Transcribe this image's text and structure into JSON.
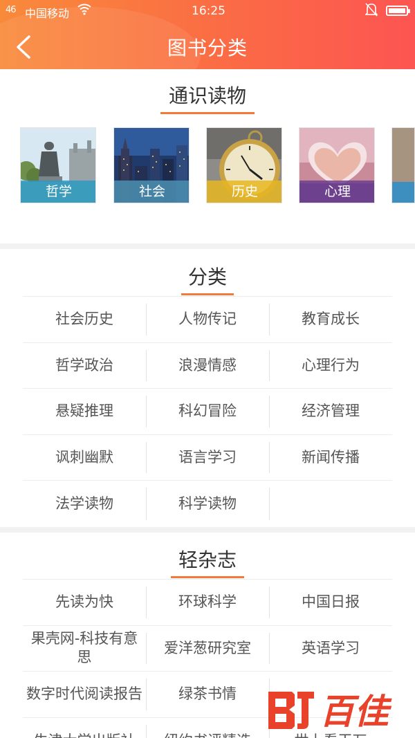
{
  "status_bar": {
    "signal": "46",
    "carrier": "中国移动",
    "time": "16:25"
  },
  "header": {
    "title": "图书分类"
  },
  "general_reading": {
    "title": "通识读物",
    "topics": [
      {
        "label": "哲学",
        "band_color": "#2e97c9",
        "icon": "statue-image"
      },
      {
        "label": "社会",
        "band_color": "#4a8fb0",
        "icon": "city-skyline-image"
      },
      {
        "label": "历史",
        "band_color": "#e6b621",
        "icon": "pocket-watch-image"
      },
      {
        "label": "心理",
        "band_color": "#6c3f8f",
        "icon": "book-heart-image"
      }
    ]
  },
  "categories": {
    "title": "分类",
    "rows": [
      [
        "社会历史",
        "人物传记",
        "教育成长"
      ],
      [
        "哲学政治",
        "浪漫情感",
        "心理行为"
      ],
      [
        "悬疑推理",
        "科幻冒险",
        "经济管理"
      ],
      [
        "讽刺幽默",
        "语言学习",
        "新闻传播"
      ],
      [
        "法学读物",
        "科学读物",
        ""
      ]
    ]
  },
  "light_magazines": {
    "title": "轻杂志",
    "rows": [
      [
        "先读为快",
        "环球科学",
        "中国日报"
      ],
      [
        "果壳网-科技有意思",
        "爱洋葱研究室",
        "英语学习"
      ],
      [
        "数字时代阅读报告",
        "绿茶书情",
        ""
      ],
      [
        "牛津大学出版社",
        "纽约书评精选",
        "世上看干万"
      ]
    ]
  },
  "watermark": {
    "text": "百佳"
  },
  "colors": {
    "header_start": "#f98a3a",
    "header_end": "#fd5552",
    "accent_underline": "#f47a3b",
    "watermark": "#e8422b"
  }
}
